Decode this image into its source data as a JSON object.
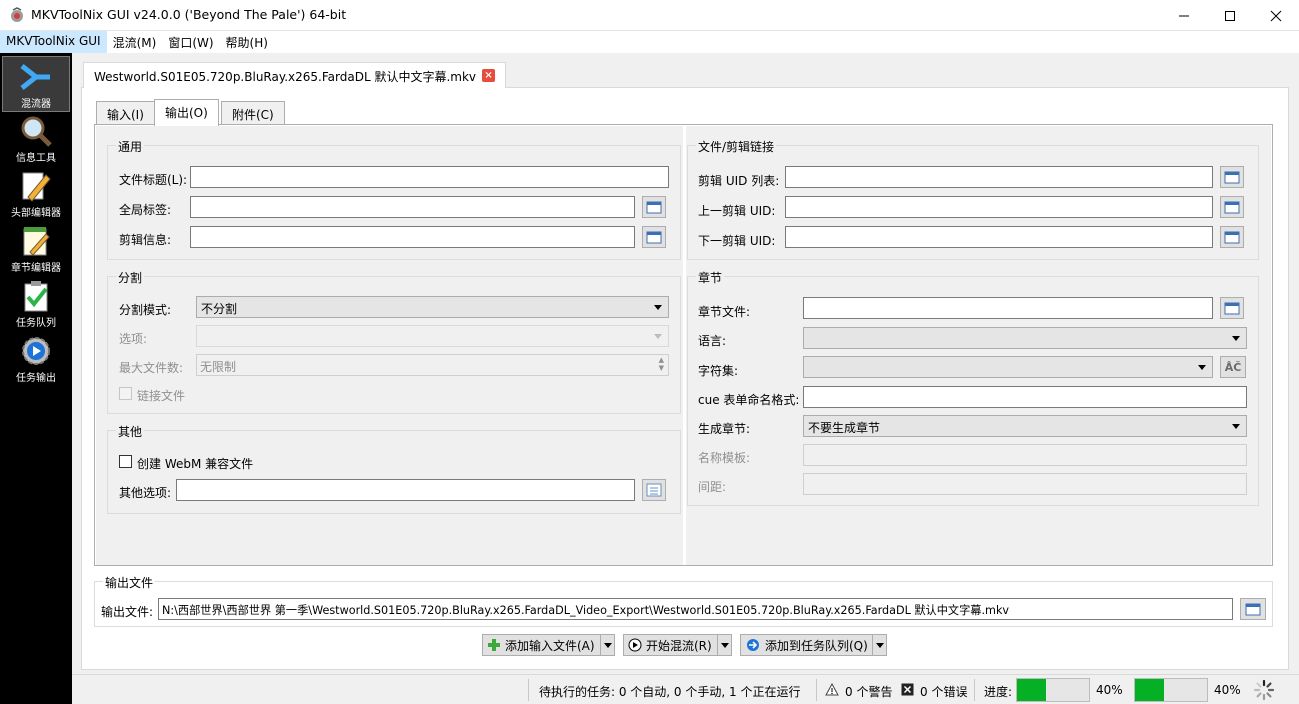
{
  "window": {
    "title": "MKVToolNix GUI v24.0.0 ('Beyond The Pale') 64-bit"
  },
  "menu": [
    "MKVToolNix GUI",
    "混流(M)",
    "窗口(W)",
    "帮助(H)"
  ],
  "sidebar": [
    {
      "label": "混流器",
      "icon": "merge-arrow-icon",
      "active": true
    },
    {
      "label": "信息工具",
      "icon": "magnifier-icon"
    },
    {
      "label": "头部编辑器",
      "icon": "pencil-icon"
    },
    {
      "label": "章节编辑器",
      "icon": "notepad-icon"
    },
    {
      "label": "任务队列",
      "icon": "clipboard-check-icon"
    },
    {
      "label": "任务输出",
      "icon": "gear-play-icon"
    }
  ],
  "doc_tab": {
    "label": "Westworld.S01E05.720p.BluRay.x265.FardaDL 默认中文字幕.mkv"
  },
  "subtabs": [
    "输入(I)",
    "输出(O)",
    "附件(C)"
  ],
  "general": {
    "title": "通用",
    "file_title_label": "文件标题(L):",
    "file_title_value": "",
    "global_tags_label": "全局标签:",
    "global_tags_value": "",
    "segment_info_label": "剪辑信息:",
    "segment_info_value": ""
  },
  "split": {
    "title": "分割",
    "mode_label": "分割模式:",
    "mode_value": "不分割",
    "options_label": "选项:",
    "options_value": "",
    "max_files_label": "最大文件数:",
    "max_files_value": "无限制",
    "link_files_label": "链接文件"
  },
  "misc": {
    "title": "其他",
    "webm_label": "创建 WebM 兼容文件",
    "other_options_label": "其他选项:",
    "other_options_value": ""
  },
  "segment_linking": {
    "title": "文件/剪辑链接",
    "uid_list_label": "剪辑 UID 列表:",
    "prev_uid_label": "上一剪辑 UID:",
    "next_uid_label": "下一剪辑 UID:"
  },
  "chapters": {
    "title": "章节",
    "file_label": "章节文件:",
    "language_label": "语言:",
    "charset_label": "字符集:",
    "cue_label": "cue 表单命名格式:",
    "generate_label": "生成章节:",
    "generate_value": "不要生成章节",
    "name_template_label": "名称模板:",
    "interval_label": "间距:"
  },
  "output": {
    "title": "输出文件",
    "label": "输出文件:",
    "value": "N:\\西部世界\\西部世界 第一季\\Westworld.S01E05.720p.BluRay.x265.FardaDL_Video_Export\\Westworld.S01E05.720p.BluRay.x265.FardaDL 默认中文字幕.mkv"
  },
  "actions": {
    "add_input": "添加输入文件(A)",
    "start_mux": "开始混流(R)",
    "add_queue": "添加到任务队列(Q)"
  },
  "status": {
    "pending": "待执行的任务: 0 个自动, 0 个手动, 1 个正在运行",
    "warnings": "0 个警告",
    "errors": "0 个错误",
    "progress_label": "进度:",
    "progress1": 40,
    "progress1_text": "40%",
    "progress2": 40,
    "progress2_text": "40%"
  },
  "colors": {
    "progress_fill": "#06b025",
    "accent_menu": "#cce8ff",
    "sidebar_bg": "#000000"
  }
}
